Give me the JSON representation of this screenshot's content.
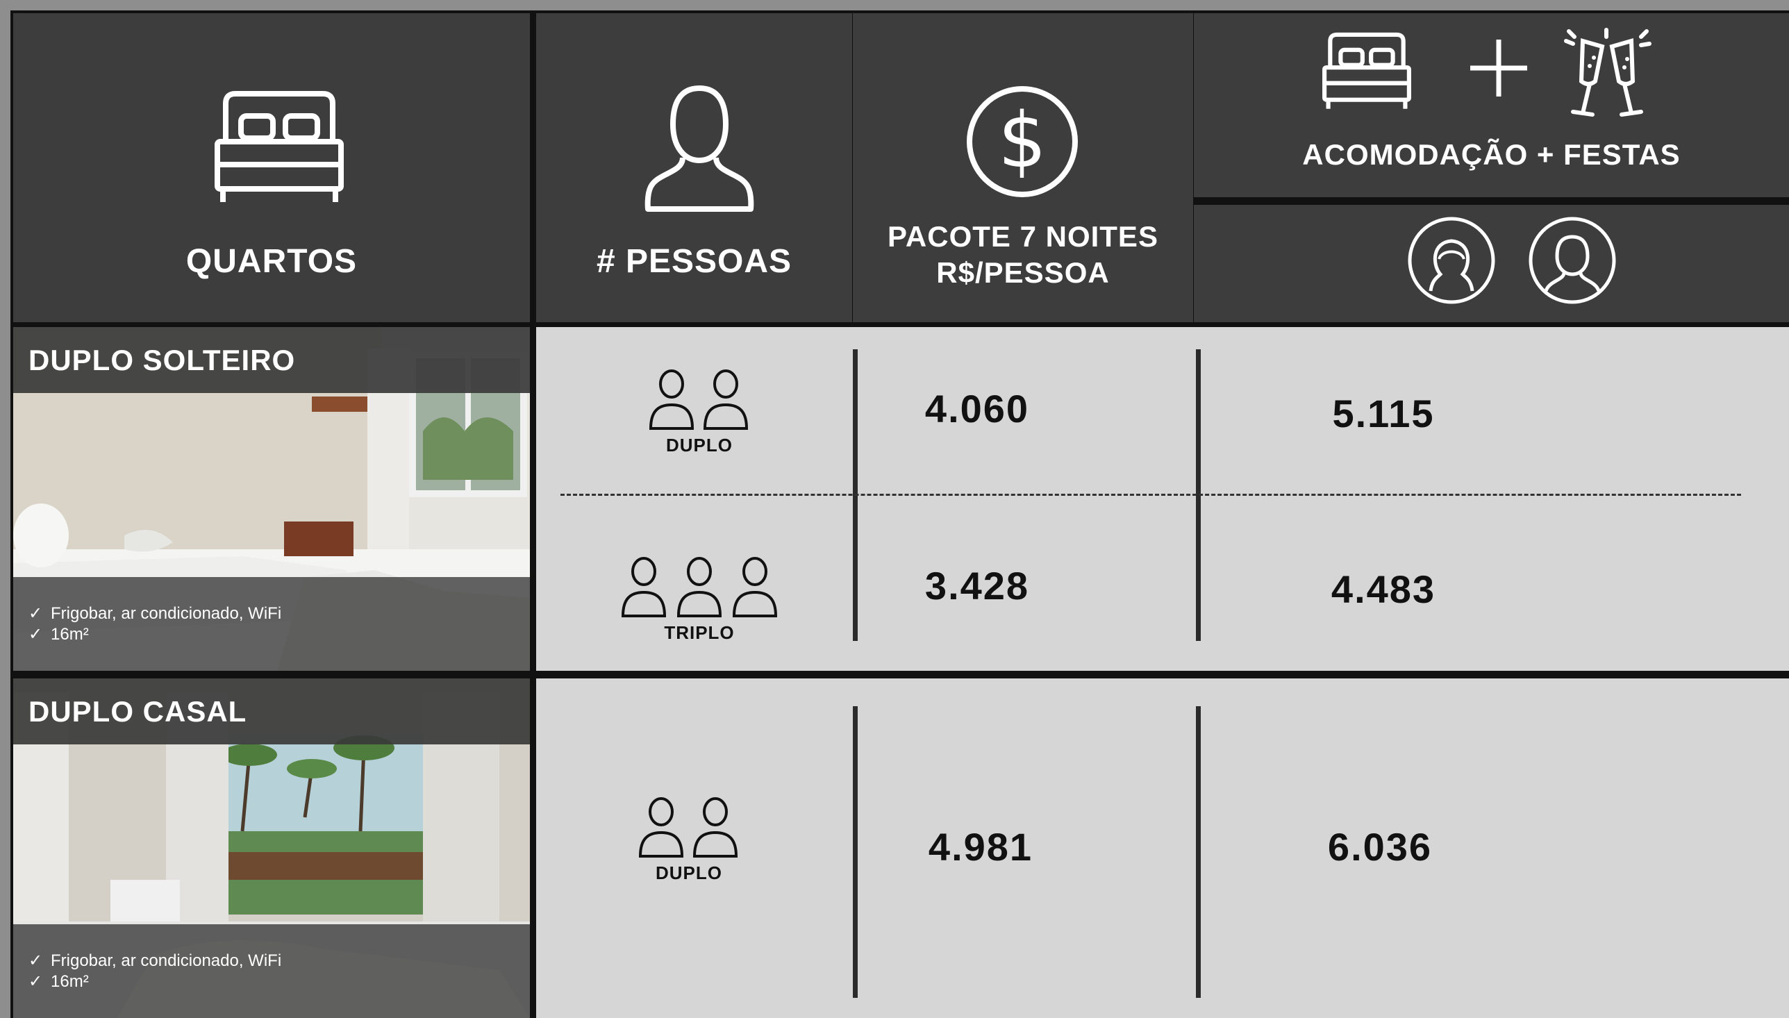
{
  "header": {
    "rooms_label": "QUARTOS",
    "people_label": "# PESSOAS",
    "package_line1": "PACOTE 7 NOITES",
    "package_line2": "R$/PESSOA",
    "accom_party_label": "ACOMODAÇÃO + FESTAS",
    "icons": [
      "bed-icon",
      "person-icon",
      "dollar-icon",
      "plus-icon",
      "champagne-icon",
      "female-avatar-icon",
      "male-avatar-icon"
    ]
  },
  "rooms": [
    {
      "name": "DUPLO SOLTEIRO",
      "features": [
        "Frigobar, ar condicionado, WiFi",
        "16m²"
      ],
      "options": [
        {
          "occupancy": "DUPLO",
          "package_price": "4.060",
          "accom_party_price": "5.115"
        },
        {
          "occupancy": "TRIPLO",
          "package_price": "3.428",
          "accom_party_price": "4.483"
        }
      ]
    },
    {
      "name": "DUPLO CASAL",
      "features": [
        "Frigobar, ar condicionado, WiFi",
        "16m²"
      ],
      "options": [
        {
          "occupancy": "DUPLO",
          "package_price": "4.981",
          "accom_party_price": "6.036"
        }
      ]
    }
  ],
  "check_mark": "✓",
  "colors": {
    "header_bg": "#3d3d3d",
    "data_bg": "#d6d6d6",
    "divider": "#111111"
  }
}
